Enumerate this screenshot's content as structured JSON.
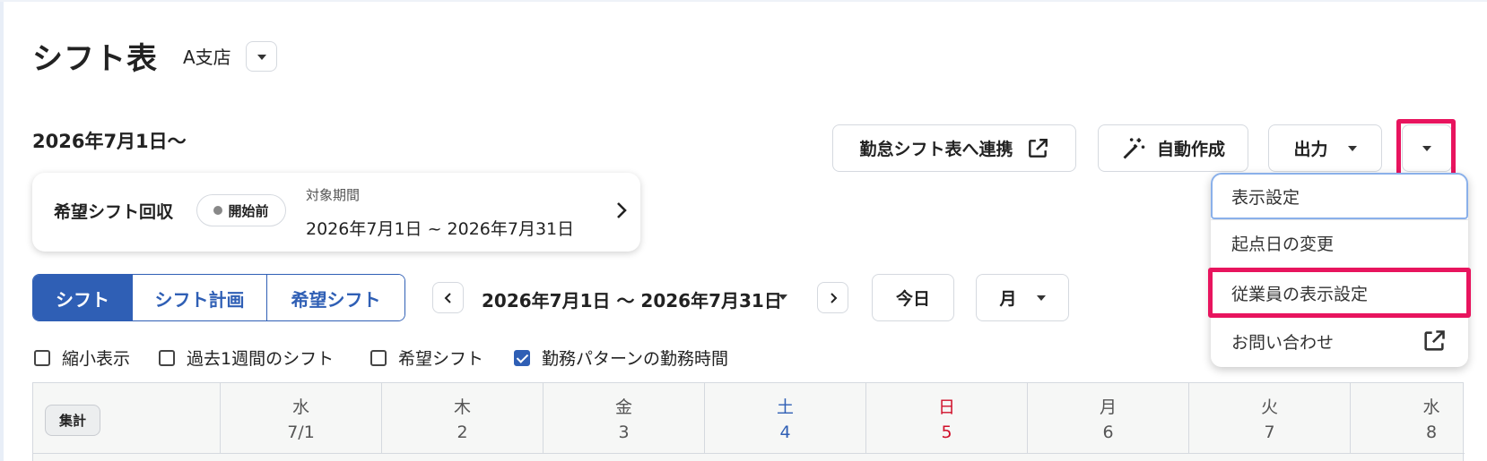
{
  "header": {
    "title": "シフト表",
    "store": "A支店"
  },
  "date_heading": "2026年7月1日〜",
  "toolbar": {
    "link_label": "勤怠シフト表へ連携",
    "auto_label": "自動作成",
    "output_label": "出力"
  },
  "request_card": {
    "title": "希望シフト回収",
    "status": "開始前",
    "period_label": "対象期間",
    "period_value": "2026年7月1日 ~ 2026年7月31日"
  },
  "view_tabs": [
    {
      "label": "シフト",
      "active": true
    },
    {
      "label": "シフト計画",
      "active": false
    },
    {
      "label": "希望シフト",
      "active": false
    }
  ],
  "range": {
    "label": "2026年7月1日 〜 2026年7月31日",
    "today_label": "今日",
    "unit_label": "月"
  },
  "options": [
    {
      "label": "縮小表示",
      "checked": false
    },
    {
      "label": "過去1週間のシフト",
      "checked": false
    },
    {
      "label": "希望シフト",
      "checked": false
    },
    {
      "label": "勤務パターンの勤務時間",
      "checked": true
    }
  ],
  "calendar": {
    "aggregate_label": "集計",
    "days": [
      {
        "dow": "水",
        "date": "7/1",
        "kind": "weekday"
      },
      {
        "dow": "木",
        "date": "2",
        "kind": "weekday"
      },
      {
        "dow": "金",
        "date": "3",
        "kind": "weekday"
      },
      {
        "dow": "土",
        "date": "4",
        "kind": "sat"
      },
      {
        "dow": "日",
        "date": "5",
        "kind": "sun"
      },
      {
        "dow": "月",
        "date": "6",
        "kind": "weekday"
      },
      {
        "dow": "火",
        "date": "7",
        "kind": "weekday"
      },
      {
        "dow": "水",
        "date": "8",
        "kind": "weekday"
      }
    ]
  },
  "menu": {
    "items": [
      {
        "label": "表示設定"
      },
      {
        "label": "起点日の変更"
      },
      {
        "label": "従業員の表示設定"
      },
      {
        "label": "お問い合わせ",
        "icon": "external-link-icon"
      }
    ]
  },
  "colors": {
    "primary": "#2f5fb5",
    "highlight": "#e8145e",
    "saturday": "#2f5fb5",
    "sunday": "#d0102a"
  }
}
